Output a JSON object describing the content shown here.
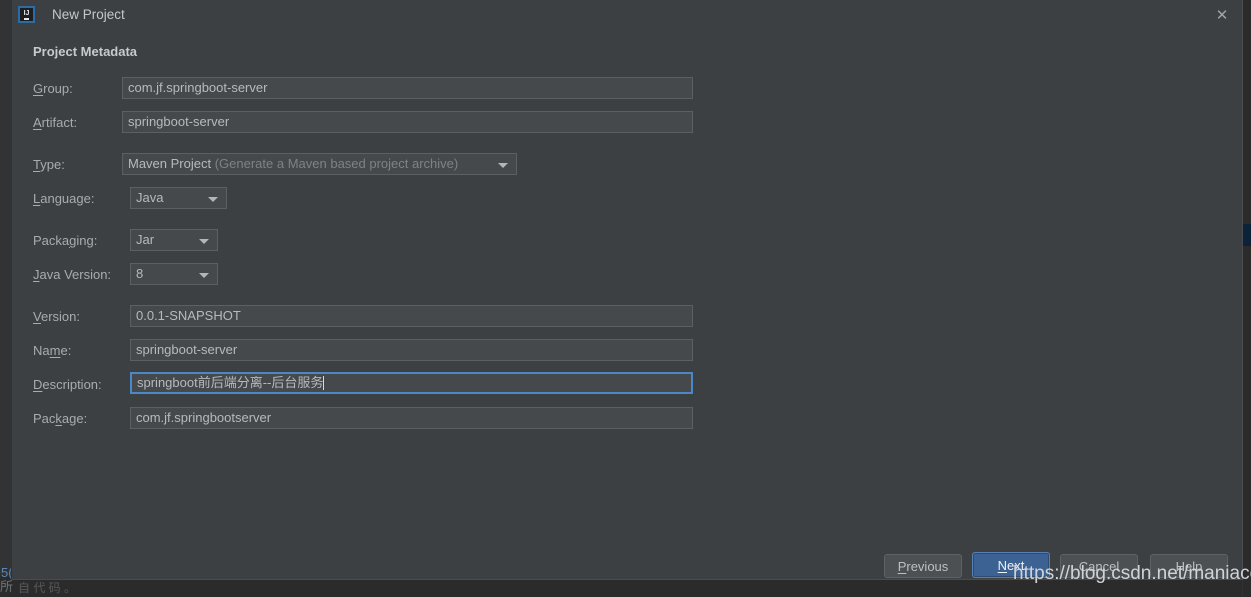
{
  "window": {
    "title": "New Project",
    "app_icon": "intellij-idea-icon",
    "close_icon": "close-icon"
  },
  "form": {
    "section_title": "Project Metadata",
    "rows": [
      {
        "label_pre": "",
        "mnemonic": "G",
        "label_post": "roup:",
        "type": "text",
        "value": "com.jf.springboot-server",
        "focused": false
      },
      {
        "label_pre": "",
        "mnemonic": "A",
        "label_post": "rtifact:",
        "type": "text",
        "value": "springboot-server",
        "focused": false
      },
      {
        "label_pre": "",
        "mnemonic": "T",
        "label_post": "ype:",
        "type": "combo",
        "value": "Maven Project",
        "hint": "(Generate a Maven based project archive)"
      },
      {
        "label_pre": "",
        "mnemonic": "L",
        "label_post": "anguage:",
        "type": "combo",
        "value": "Java",
        "hint": ""
      },
      {
        "label_pre": "Packa",
        "mnemonic": "g",
        "label_post": "ing:",
        "type": "combo",
        "value": "Jar",
        "hint": ""
      },
      {
        "label_pre": "",
        "mnemonic": "J",
        "label_post": "ava Version:",
        "type": "combo",
        "value": "8",
        "hint": ""
      },
      {
        "label_pre": "",
        "mnemonic": "V",
        "label_post": "ersion:",
        "type": "text",
        "value": "0.0.1-SNAPSHOT",
        "focused": false
      },
      {
        "label_pre": "Na",
        "mnemonic": "m",
        "label_post": "e:",
        "type": "text",
        "value": "springboot-server",
        "focused": false
      },
      {
        "label_pre": "",
        "mnemonic": "D",
        "label_post": "escription:",
        "type": "text",
        "value": "springboot前后端分离--后台服务",
        "focused": true
      },
      {
        "label_pre": "Pac",
        "mnemonic": "k",
        "label_post": "age:",
        "type": "text",
        "value": "com.jf.springbootserver",
        "focused": false
      }
    ]
  },
  "footer": {
    "buttons": [
      {
        "label_pre": "",
        "mnemonic": "P",
        "label_post": "revious",
        "name": "previous-button",
        "primary": false
      },
      {
        "label_pre": "",
        "mnemonic": "N",
        "label_post": "ext",
        "name": "next-button",
        "primary": true
      },
      {
        "label_pre": "Cancel",
        "mnemonic": "",
        "label_post": "",
        "name": "cancel-button",
        "primary": false
      },
      {
        "label_pre": "Help",
        "mnemonic": "",
        "label_post": "",
        "name": "help-button",
        "primary": false
      }
    ]
  },
  "watermark": {
    "text": "https://blog.csdn.net/maniacer"
  },
  "background": {
    "clipped_glyph_left": "所",
    "clipped_glyph_blue": "5(",
    "clipped_glyph_bottom": "自 代 码 。"
  },
  "colors": {
    "dialog_bg": "#3c4043",
    "field_bg": "#45494b",
    "field_border": "#5c6063",
    "focus_border": "#4a88c7",
    "primary_button": "#3c6293",
    "text": "#b7babc",
    "accent_strip": "#0b2239"
  }
}
